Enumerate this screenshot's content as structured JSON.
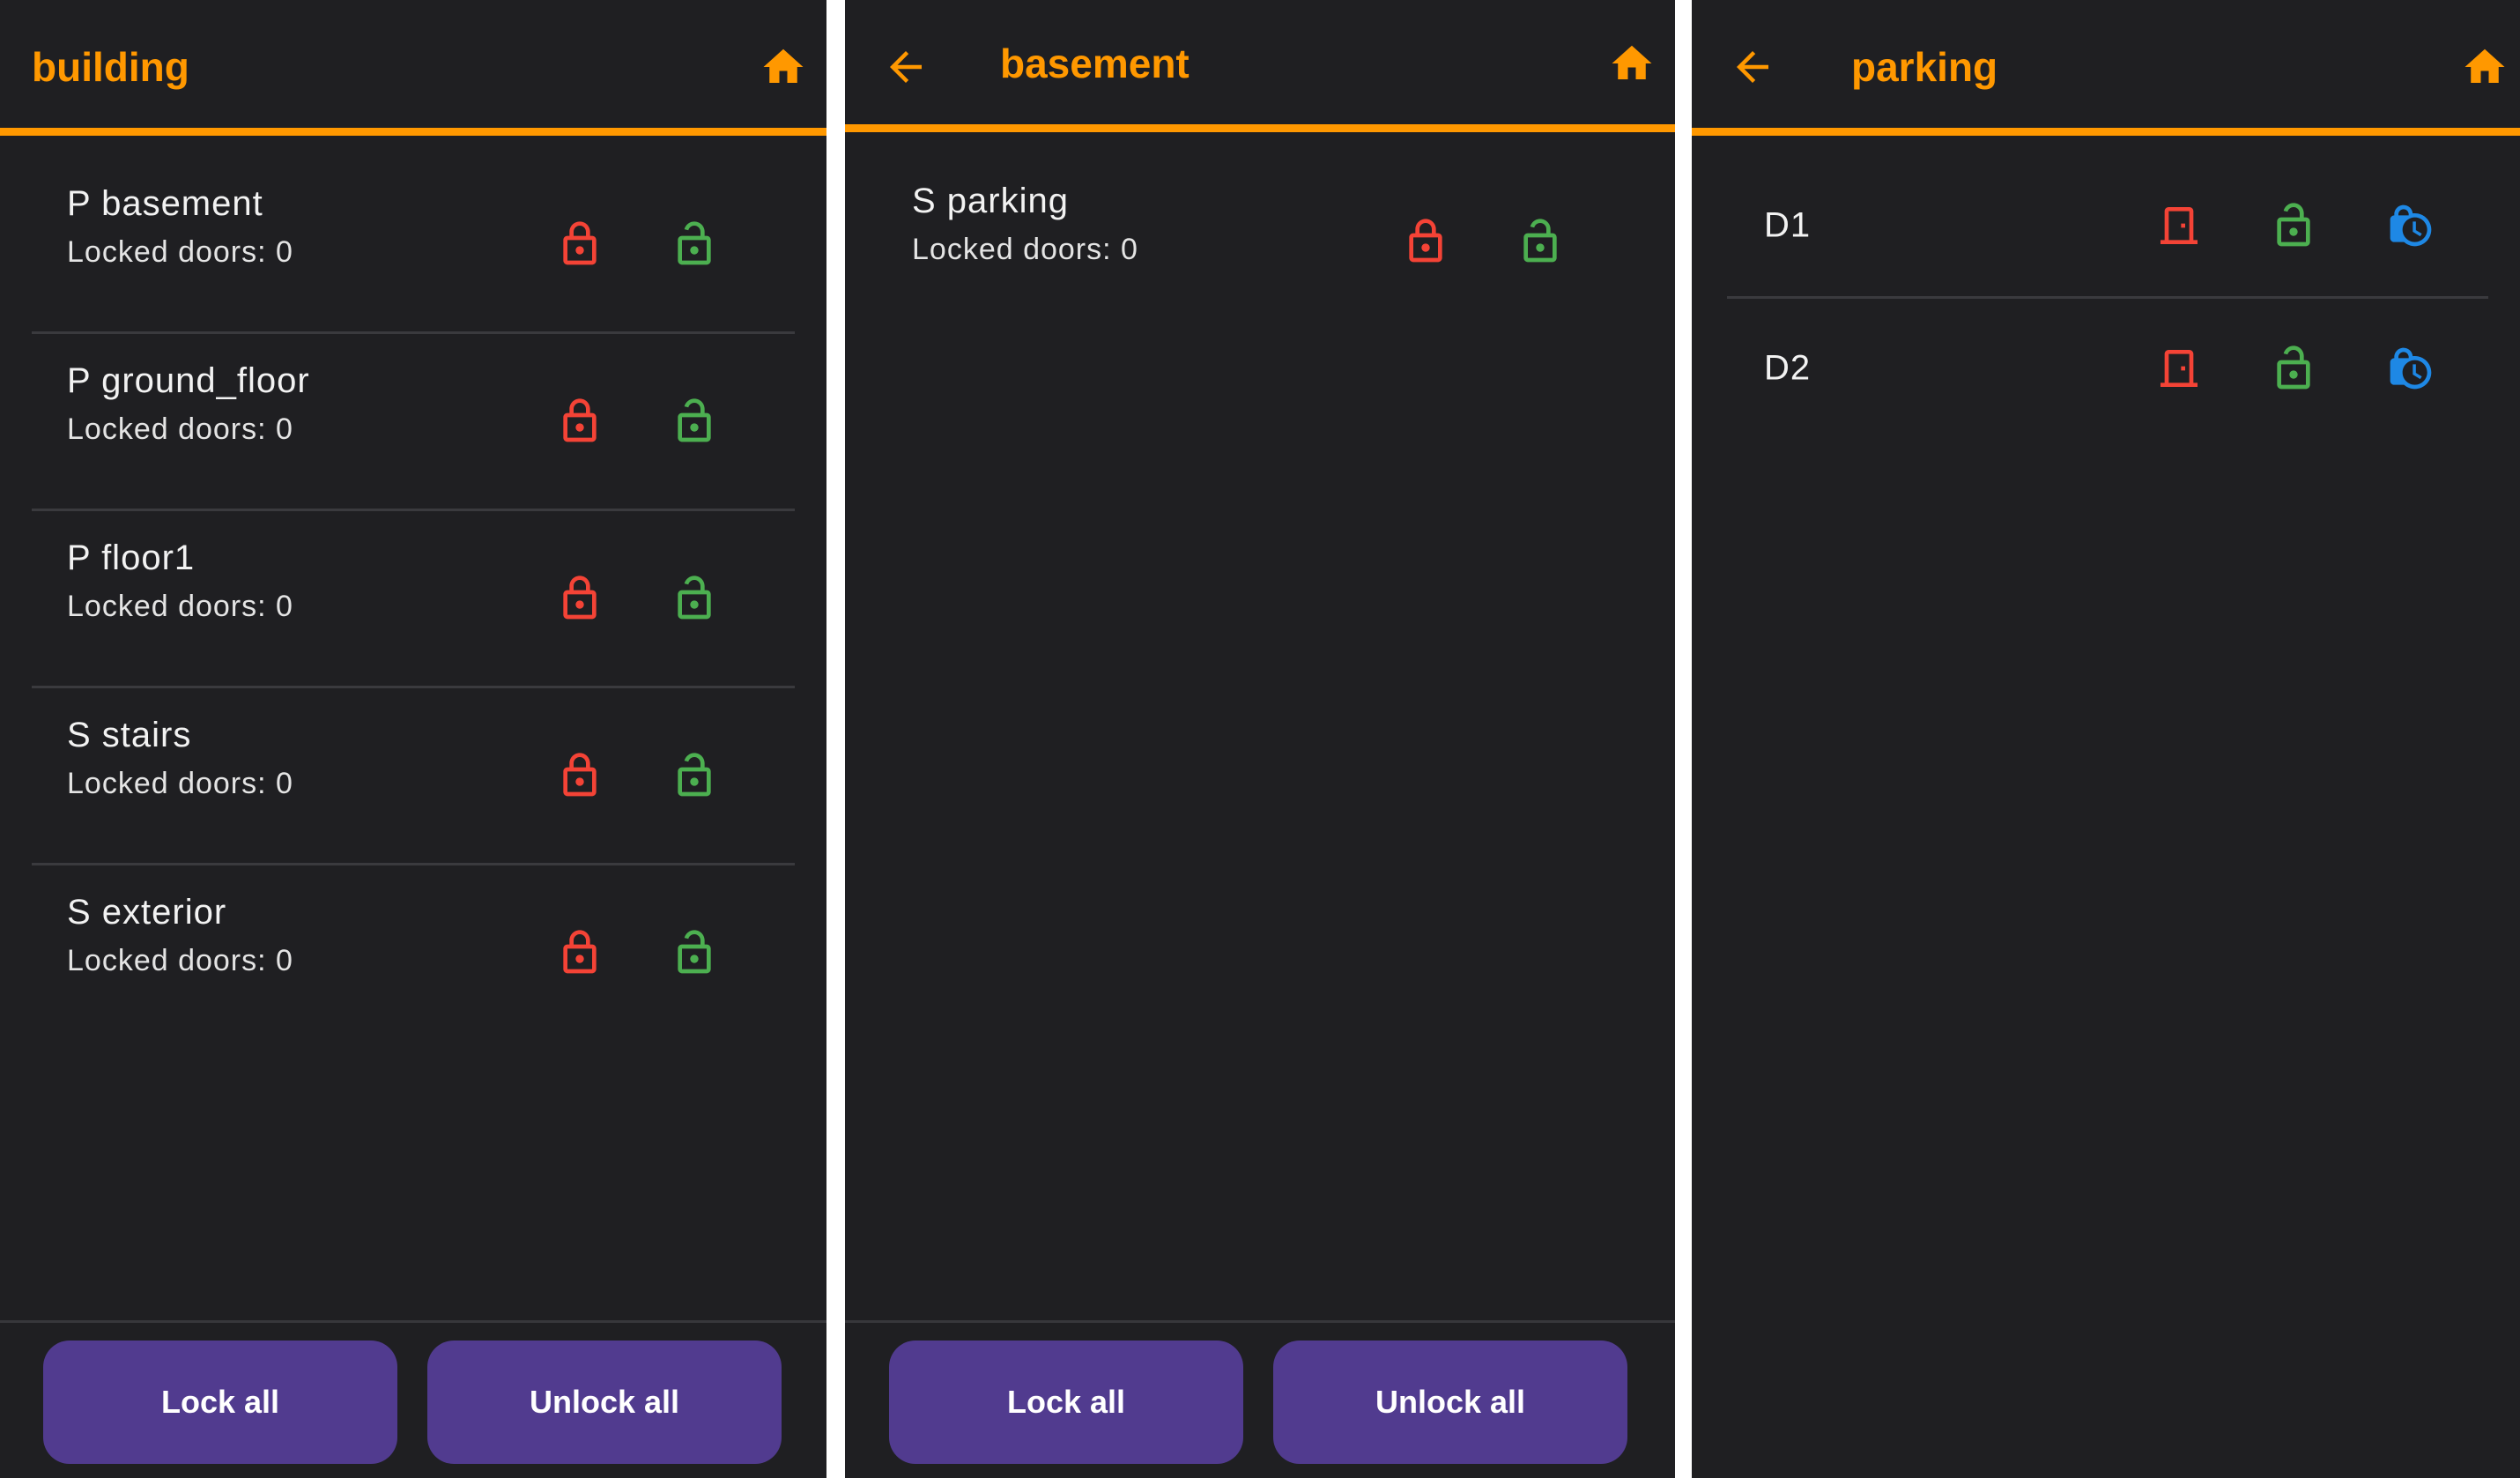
{
  "colors": {
    "accent": "#ff9800",
    "lock": "#f44336",
    "unlock": "#4caf50",
    "schedule": "#1e88e5",
    "button": "#513b8f",
    "background": "#1f1f22",
    "divider": "#3a3a3e"
  },
  "icons": {
    "home": "home-icon",
    "back": "arrow-back-icon",
    "lock": "lock-icon",
    "unlock": "lock-open-icon",
    "door": "door-icon",
    "schedule": "lock-clock-icon"
  },
  "screens": [
    {
      "title": "building",
      "has_back": false,
      "rows": [
        {
          "name": "P basement",
          "subtitle": "Locked doors: 0"
        },
        {
          "name": "P ground_floor",
          "subtitle": "Locked doors: 0"
        },
        {
          "name": "P floor1",
          "subtitle": "Locked doors: 0"
        },
        {
          "name": "S stairs",
          "subtitle": "Locked doors: 0"
        },
        {
          "name": "S exterior",
          "subtitle": "Locked doors: 0"
        }
      ],
      "footer": {
        "lock_all": "Lock all",
        "unlock_all": "Unlock all"
      }
    },
    {
      "title": "basement",
      "has_back": true,
      "rows": [
        {
          "name": "S parking",
          "subtitle": "Locked doors: 0"
        }
      ],
      "footer": {
        "lock_all": "Lock all",
        "unlock_all": "Unlock all"
      }
    },
    {
      "title": "parking",
      "has_back": true,
      "doors": [
        {
          "name": "D1"
        },
        {
          "name": "D2"
        }
      ]
    }
  ]
}
